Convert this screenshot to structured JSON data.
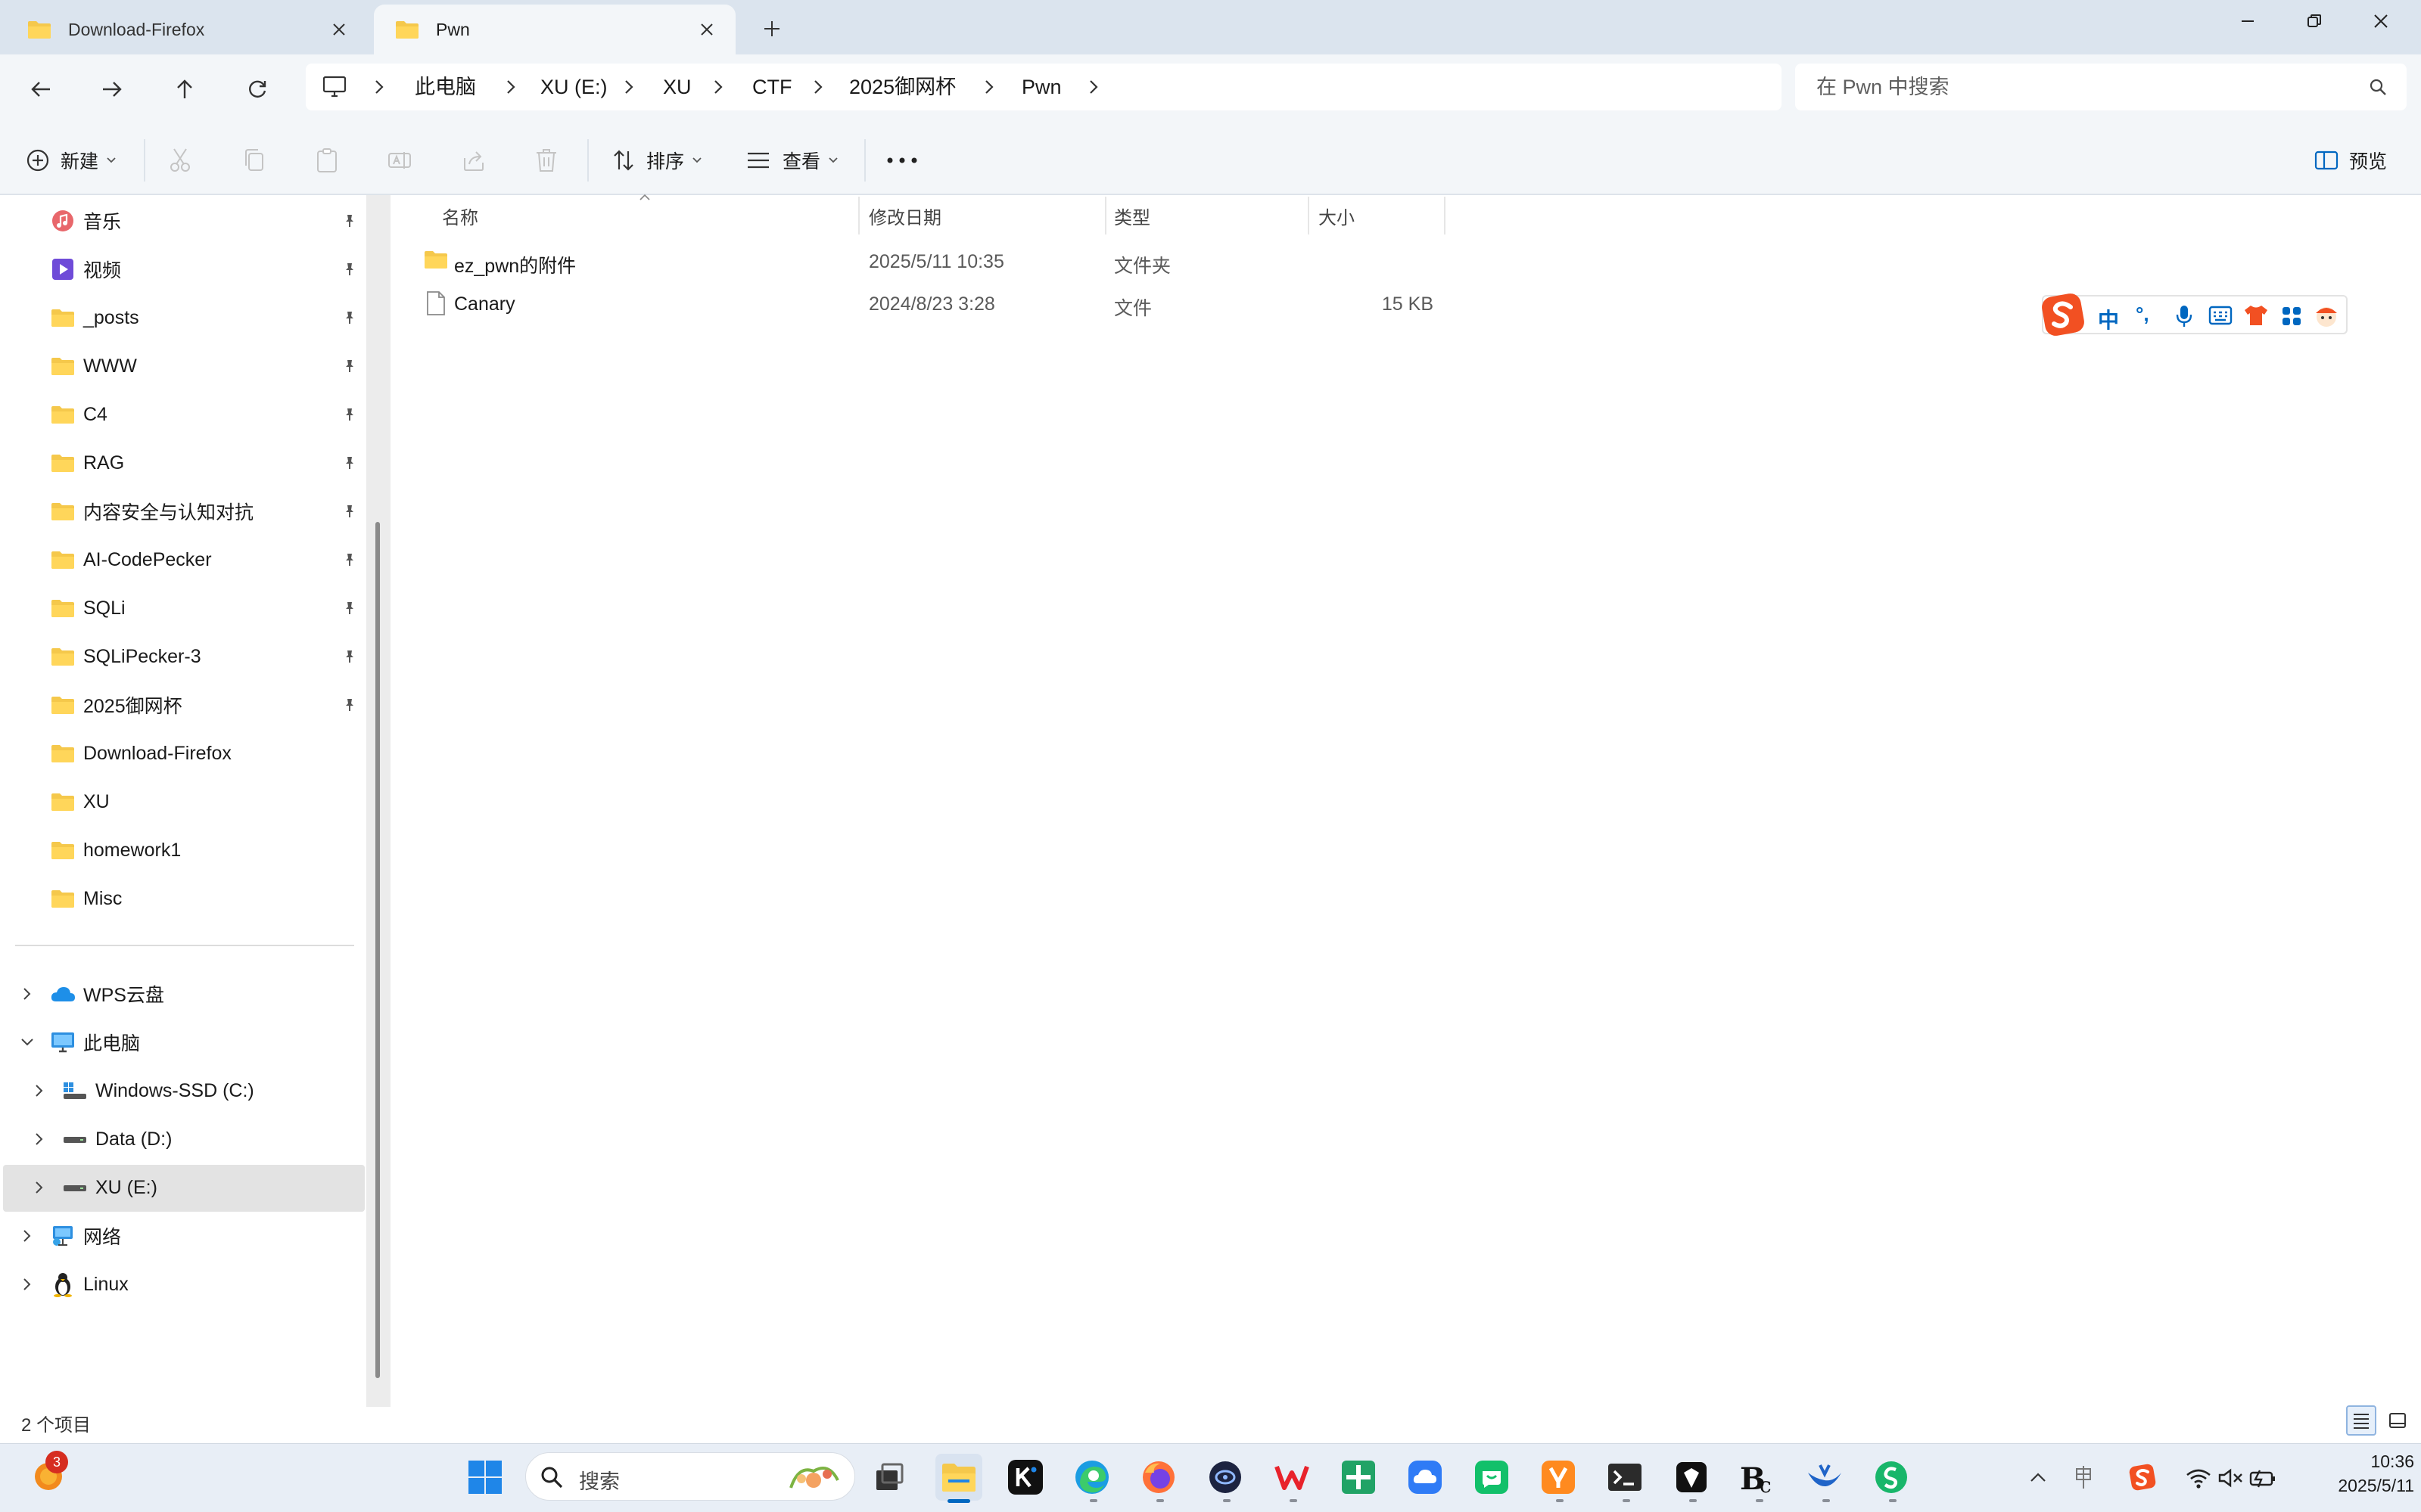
{
  "tabs": [
    {
      "label": "Download-Firefox",
      "active": false
    },
    {
      "label": "Pwn",
      "active": true
    }
  ],
  "breadcrumb": [
    "此电脑",
    "XU (E:)",
    "XU",
    "CTF",
    "2025御网杯",
    "Pwn"
  ],
  "search": {
    "placeholder": "在 Pwn 中搜索"
  },
  "toolbar": {
    "new_label": "新建",
    "sort_label": "排序",
    "view_label": "查看",
    "preview_label": "预览"
  },
  "sidebar": {
    "quick_access": [
      {
        "label": "音乐",
        "icon": "music-icon",
        "pinned": true
      },
      {
        "label": "视频",
        "icon": "video-icon",
        "pinned": true
      },
      {
        "label": "_posts",
        "icon": "folder-icon",
        "pinned": true
      },
      {
        "label": "WWW",
        "icon": "folder-icon",
        "pinned": true
      },
      {
        "label": "C4",
        "icon": "folder-icon",
        "pinned": true
      },
      {
        "label": "RAG",
        "icon": "folder-icon",
        "pinned": true
      },
      {
        "label": "内容安全与认知对抗",
        "icon": "folder-icon",
        "pinned": true
      },
      {
        "label": "AI-CodePecker",
        "icon": "folder-icon",
        "pinned": true
      },
      {
        "label": "SQLi",
        "icon": "folder-icon",
        "pinned": true
      },
      {
        "label": "SQLiPecker-3",
        "icon": "folder-icon",
        "pinned": true
      },
      {
        "label": "2025御网杯",
        "icon": "folder-icon",
        "pinned": true
      },
      {
        "label": "Download-Firefox",
        "icon": "folder-icon",
        "pinned": false
      },
      {
        "label": "XU",
        "icon": "folder-icon",
        "pinned": false
      },
      {
        "label": "homework1",
        "icon": "folder-icon",
        "pinned": false
      },
      {
        "label": "Misc",
        "icon": "folder-icon",
        "pinned": false
      }
    ],
    "tree": [
      {
        "label": "WPS云盘",
        "icon": "cloud-icon",
        "expanded": false
      },
      {
        "label": "此电脑",
        "icon": "computer-icon",
        "expanded": true
      },
      {
        "label": "Windows-SSD (C:)",
        "icon": "drive-icon",
        "expanded": false
      },
      {
        "label": "Data (D:)",
        "icon": "drive-icon",
        "expanded": false
      },
      {
        "label": "XU (E:)",
        "icon": "drive-icon",
        "expanded": false,
        "selected": true
      },
      {
        "label": "网络",
        "icon": "network-icon",
        "expanded": false
      },
      {
        "label": "Linux",
        "icon": "linux-icon",
        "expanded": false
      }
    ]
  },
  "columns": {
    "name": "名称",
    "date": "修改日期",
    "type": "类型",
    "size": "大小"
  },
  "files": [
    {
      "name": "ez_pwn的附件",
      "date": "2025/5/11 10:35",
      "type": "文件夹",
      "size": "",
      "icon": "folder-icon"
    },
    {
      "name": "Canary",
      "date": "2024/8/23 3:28",
      "type": "文件",
      "size": "15 KB",
      "icon": "file-icon"
    }
  ],
  "ime": {
    "mode": "中",
    "punct": "°,"
  },
  "status": {
    "item_count": "2 个项目"
  },
  "taskbar": {
    "notification_badge": "3",
    "search_label": "搜索",
    "apps": [
      "start-icon",
      "task-view-icon",
      "file-explorer-icon",
      "kimi-icon",
      "edge-icon",
      "firefox-icon",
      "app-icon",
      "wps-icon",
      "spreadsheet-icon",
      "cloud-drive-icon",
      "wechat-icon",
      "app-icon",
      "terminal-icon",
      "app-icon",
      "app-icon",
      "app-icon",
      "app-icon"
    ],
    "time": "10:36",
    "date": "2025/5/11"
  },
  "colors": {
    "accent": "#0067c0",
    "folder": "#f5c84b",
    "titlebar": "#dbe4ee",
    "panel": "#f3f6f9"
  }
}
